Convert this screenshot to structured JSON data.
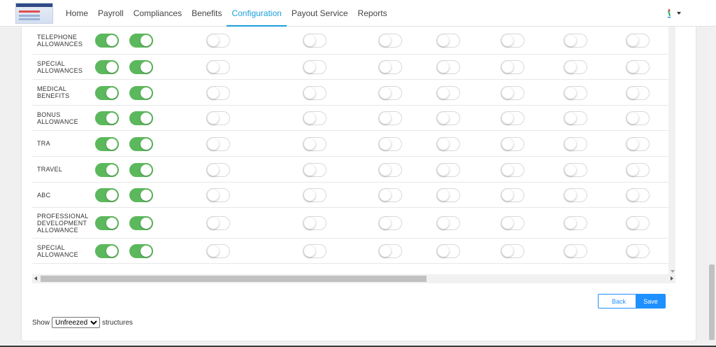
{
  "nav": {
    "items": [
      "Home",
      "Payroll",
      "Compliances",
      "Benefits",
      "Configuration",
      "Payout Service",
      "Reports"
    ],
    "active_index": 4
  },
  "rows": [
    {
      "label": "TELEPHONE ALLOWANCES",
      "toggles": [
        true,
        true,
        false,
        false,
        false,
        false,
        false,
        false,
        false
      ]
    },
    {
      "label": "SPECIAL ALLOWANCES",
      "toggles": [
        true,
        true,
        false,
        false,
        false,
        false,
        false,
        false,
        false
      ]
    },
    {
      "label": "MEDICAL BENEFITS",
      "toggles": [
        true,
        true,
        false,
        false,
        false,
        false,
        false,
        false,
        false
      ]
    },
    {
      "label": "BONUS ALLOWANCE",
      "toggles": [
        true,
        true,
        false,
        false,
        false,
        false,
        false,
        false,
        false
      ]
    },
    {
      "label": "TRA",
      "toggles": [
        true,
        true,
        false,
        false,
        false,
        false,
        false,
        false,
        false
      ]
    },
    {
      "label": "TRAVEL",
      "toggles": [
        true,
        true,
        false,
        false,
        false,
        false,
        false,
        false,
        false
      ]
    },
    {
      "label": "ABC",
      "toggles": [
        true,
        true,
        false,
        false,
        false,
        false,
        false,
        false,
        false
      ]
    },
    {
      "label": "PROFESSIONAL DEVELOPMENT ALLOWANCE",
      "toggles": [
        true,
        true,
        false,
        false,
        false,
        false,
        false,
        false,
        false
      ]
    },
    {
      "label": "SPECIAL ALLOWANCE",
      "toggles": [
        true,
        true,
        false,
        false,
        false,
        false,
        false,
        false,
        false
      ]
    }
  ],
  "actions": {
    "back_label": "Back",
    "save_label": "Save"
  },
  "footer": {
    "show_label": "Show",
    "filter_options": [
      "Unfreezed"
    ],
    "filter_selected": "Unfreezed",
    "suffix_label": "structures"
  },
  "colors": {
    "accent": "#1a9ed9",
    "toggle_on": "#5cb85c",
    "button_primary": "#1e90ff"
  },
  "icons": {
    "user": "user-logo-icon",
    "caret": "caret-down-icon"
  }
}
